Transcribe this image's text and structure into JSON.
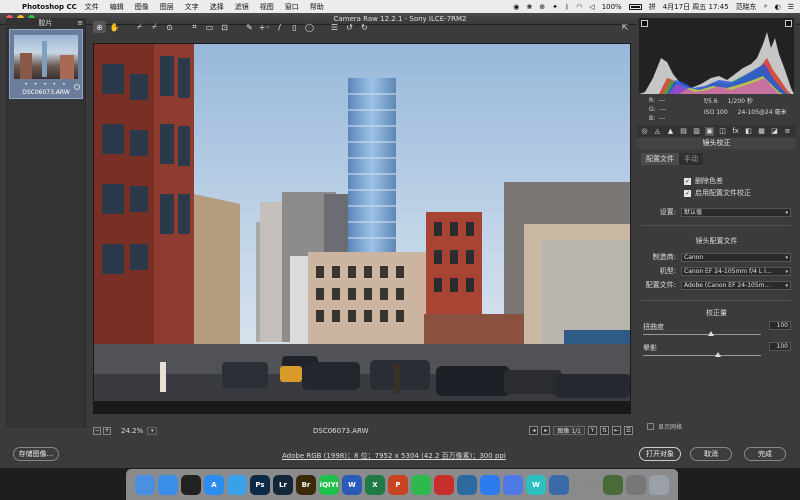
{
  "menubar": {
    "app_name": "Photoshop CC",
    "items": [
      "文件",
      "编辑",
      "图像",
      "图层",
      "文字",
      "选择",
      "滤镜",
      "视图",
      "窗口",
      "帮助"
    ],
    "battery": "100%",
    "datetime": "4月17日 周五 17:45",
    "user": "范晓东"
  },
  "window": {
    "title": "Camera Raw 12.2.1  -  Sony ILCE-7RM2"
  },
  "filmstrip": {
    "header": "胶片",
    "items": [
      {
        "filename": "DSC06073.ARW",
        "rating": "• • • • •"
      }
    ]
  },
  "toolbar": {
    "tools": [
      {
        "name": "zoom-tool-icon",
        "glyph": "⊕"
      },
      {
        "name": "hand-tool-icon",
        "glyph": "✋"
      },
      {
        "name": "white-balance-tool-icon",
        "glyph": "⌿"
      },
      {
        "name": "color-sampler-tool-icon",
        "glyph": "⌿"
      },
      {
        "name": "targeted-adjustment-tool-icon",
        "glyph": "⊙"
      },
      {
        "name": "crop-tool-icon",
        "glyph": "⌗"
      },
      {
        "name": "straighten-tool-icon",
        "glyph": "▭"
      },
      {
        "name": "transform-tool-icon",
        "glyph": "⊡"
      },
      {
        "name": "spot-removal-tool-icon",
        "glyph": "✎"
      },
      {
        "name": "red-eye-tool-icon",
        "glyph": "+◦"
      },
      {
        "name": "adjustment-brush-icon",
        "glyph": "/"
      },
      {
        "name": "graduated-filter-icon",
        "glyph": "▯"
      },
      {
        "name": "radial-filter-icon",
        "glyph": "◯"
      },
      {
        "name": "preferences-icon",
        "glyph": "☰"
      },
      {
        "name": "rotate-left-icon",
        "glyph": "↺"
      },
      {
        "name": "rotate-right-icon",
        "glyph": "↻"
      }
    ]
  },
  "status": {
    "zoom": "24.2%",
    "filename": "DSC06073.ARW",
    "image_count": "图像 1/1",
    "y_label": "Y"
  },
  "histogram": {
    "r_label": "R:",
    "g_label": "G:",
    "b_label": "B:",
    "r_value": "---",
    "g_value": "---",
    "b_value": "---",
    "aperture": "f/5.6",
    "shutter": "1/200 秒",
    "iso": "ISO 100",
    "lens": "24-105@24 毫米"
  },
  "panel": {
    "title": "镜头校正",
    "tab_profile": "配置文件",
    "tab_manual": "手动",
    "remove_ca": "删除色差",
    "enable_profile": "启用配置文件校正",
    "settings_label": "设置:",
    "settings_value": "默认值",
    "profile_section": "镜头配置文件",
    "make_label": "制造商:",
    "make_value": "Canon",
    "model_label": "机型:",
    "model_value": "Canon EF 24-105mm f/4 L I...",
    "profile_label": "配置文件:",
    "profile_value": "Adobe (Canon EF 24-105m...",
    "correction_section": "校正量",
    "distortion_label": "扭曲度",
    "distortion_value": "100",
    "vignette_label": "晕影",
    "vignette_value": "100",
    "show_grid": "显示网格"
  },
  "bottom": {
    "save_label": "存储图像...",
    "info_link": "Adobe RGB (1998)；8 位；7952 x 5304 (42.2 百万像素)；300 ppi",
    "open_label": "打开对象",
    "cancel_label": "取消",
    "done_label": "完成"
  },
  "dock": {
    "apps": [
      {
        "name": "finder-icon",
        "label": "",
        "color": "#4a8fe0"
      },
      {
        "name": "safari-icon",
        "label": "",
        "color": "#3b8ee8"
      },
      {
        "name": "qq-icon",
        "label": "",
        "color": "#222222"
      },
      {
        "name": "app-store-icon",
        "label": "A",
        "color": "#2d8cf0"
      },
      {
        "name": "qq-browser-icon",
        "label": "",
        "color": "#3aa0e8"
      },
      {
        "name": "photoshop-icon",
        "label": "Ps",
        "color": "#0b2a46"
      },
      {
        "name": "lightroom-icon",
        "label": "Lr",
        "color": "#14273a"
      },
      {
        "name": "bridge-icon",
        "label": "Br",
        "color": "#3b2a0a"
      },
      {
        "name": "iqiyi-icon",
        "label": "iQIYI",
        "color": "#1fbf4b"
      },
      {
        "name": "word-icon",
        "label": "W",
        "color": "#2b5bb8"
      },
      {
        "name": "excel-icon",
        "label": "X",
        "color": "#1f7a44"
      },
      {
        "name": "powerpoint-icon",
        "label": "P",
        "color": "#c8431f"
      },
      {
        "name": "wechat-icon",
        "label": "",
        "color": "#2fb84b"
      },
      {
        "name": "netease-music-icon",
        "label": "",
        "color": "#c9302c"
      },
      {
        "name": "mirror-icon",
        "label": "",
        "color": "#2c6aa0"
      },
      {
        "name": "zoom-app-icon",
        "label": "",
        "color": "#2d7bf0"
      },
      {
        "name": "feishu-icon",
        "label": "",
        "color": "#4f7be8"
      },
      {
        "name": "wps-icon",
        "label": "W",
        "color": "#2ec0c0"
      },
      {
        "name": "preview-icon",
        "label": "",
        "color": "#3b6aa8"
      },
      {
        "name": "photos-icon",
        "label": "",
        "color": "#8a8a8a"
      },
      {
        "name": "screen-share-icon",
        "label": "",
        "color": "#4a6a3a"
      },
      {
        "name": "disk-utility-icon",
        "label": "",
        "color": "#777777"
      },
      {
        "name": "trash-icon",
        "label": "",
        "color": "#9aa0a8"
      }
    ]
  },
  "colors": {
    "panel_bg": "#3b3b3b",
    "menubar_bg": "#ececec",
    "photo_sky": "#b8cfe6",
    "accent_red": "#d43a28"
  }
}
